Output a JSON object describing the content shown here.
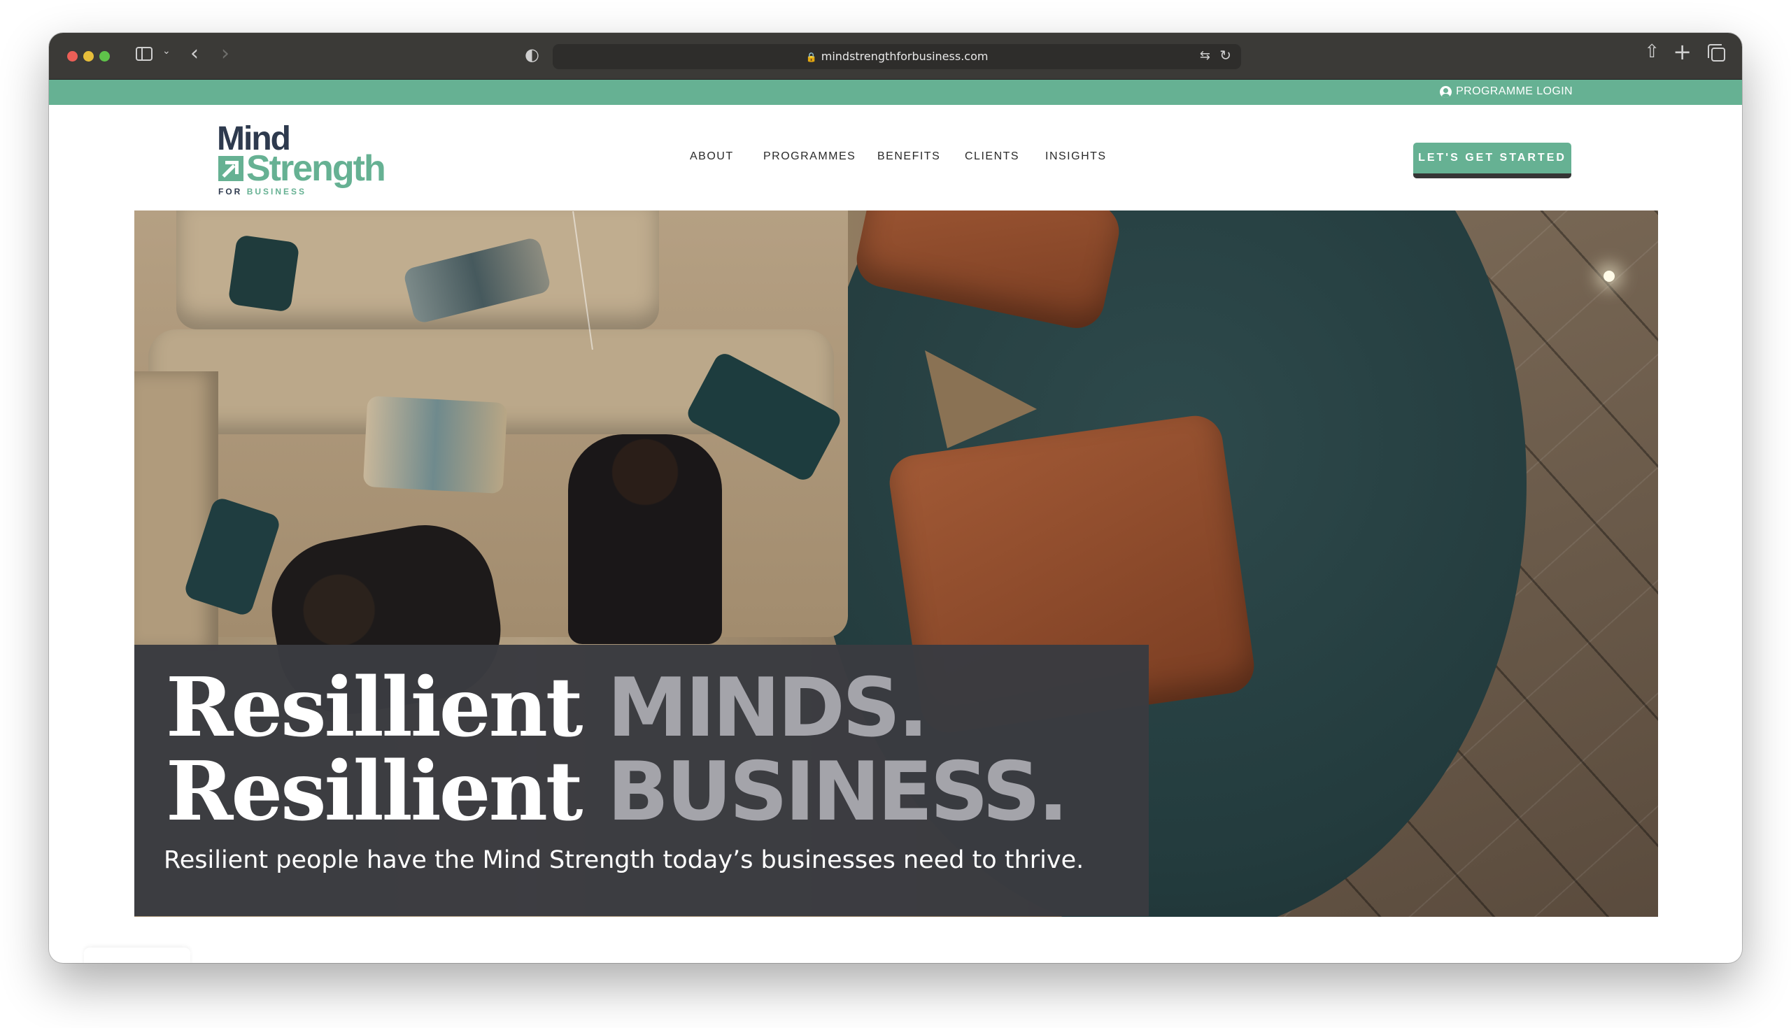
{
  "browser": {
    "url": "mindstrengthforbusiness.com"
  },
  "topbar": {
    "login_label": "PROGRAMME LOGIN"
  },
  "logo": {
    "word1": "Mind",
    "word2": "Strength",
    "tagline_for": "FOR",
    "tagline_business": "BUSINESS"
  },
  "nav": {
    "items": [
      {
        "label": "ABOUT"
      },
      {
        "label": "PROGRAMMES"
      },
      {
        "label": "BENEFITS"
      },
      {
        "label": "CLIENTS"
      },
      {
        "label": "INSIGHTS"
      }
    ]
  },
  "cta": {
    "label": "LET'S GET STARTED"
  },
  "hero": {
    "line1_a": "Resillient",
    "line1_b": "MINDS.",
    "line2_a": "Resillient",
    "line2_b": "BUSINESS.",
    "subtitle": "Resilient people have the Mind Strength today’s businesses need to thrive."
  },
  "colors": {
    "brand_green": "#66b193",
    "brand_navy": "#2e3a4e",
    "hero_panel": "#3a3b40",
    "hero_accent_text": "#a4a4aa"
  }
}
